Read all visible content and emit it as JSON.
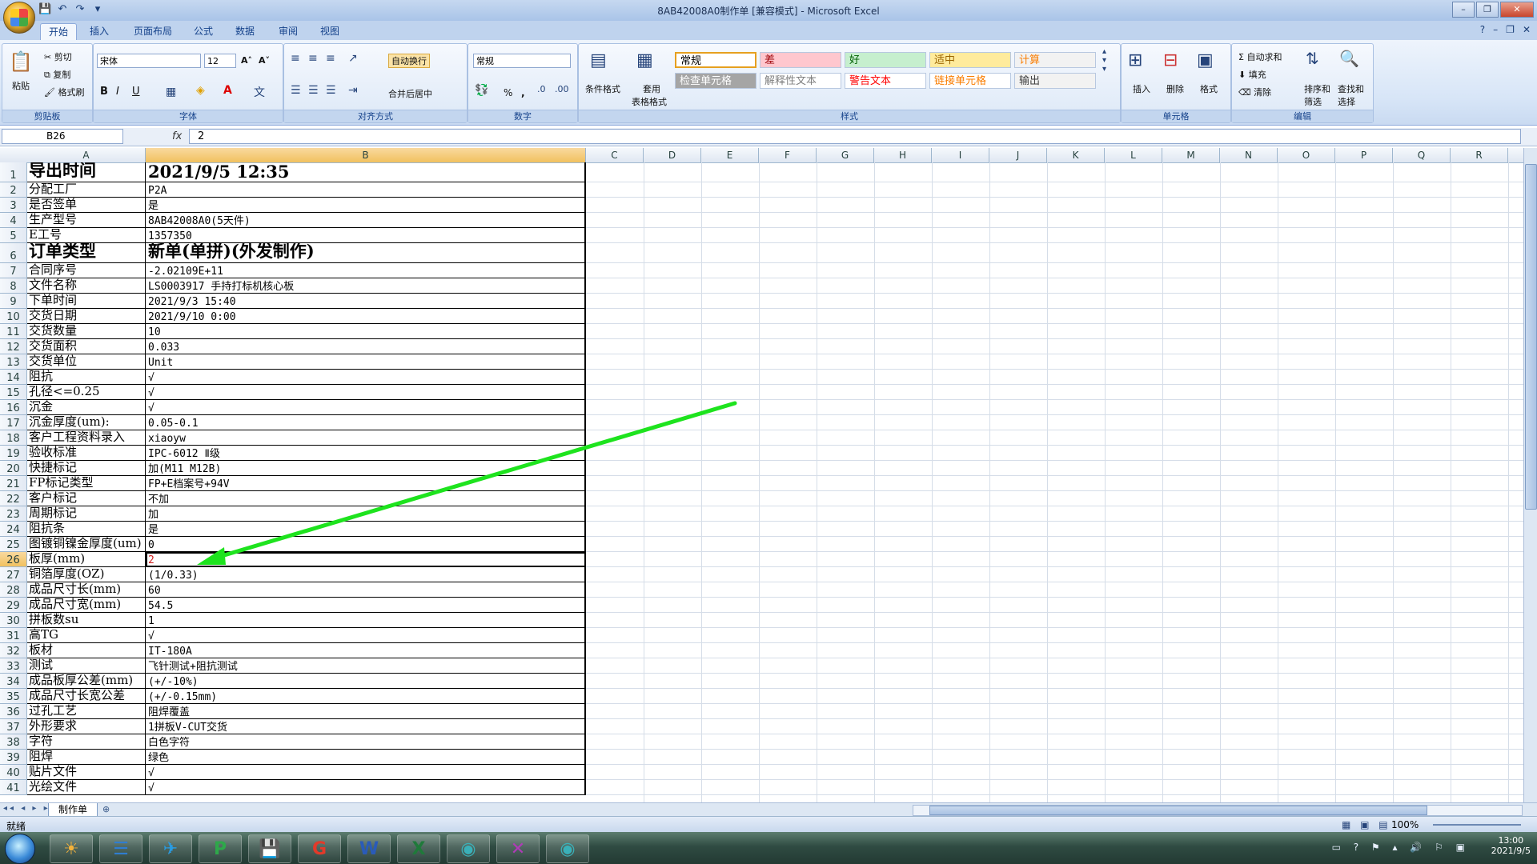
{
  "window": {
    "title": "8AB42008A0制作单  [兼容模式] - Microsoft Excel",
    "controls": [
      "–",
      "❐",
      "✕"
    ]
  },
  "qat": [
    "💾",
    "↶",
    "↷",
    "▾"
  ],
  "tabs": [
    "开始",
    "插入",
    "页面布局",
    "公式",
    "数据",
    "审阅",
    "视图"
  ],
  "ribbon": {
    "clipboard": {
      "paste": "粘贴",
      "cut": "剪切",
      "copy": "复制",
      "format_painter": "格式刷",
      "label": "剪贴板"
    },
    "font": {
      "name": "宋体",
      "size": "12",
      "bold": "B",
      "italic": "I",
      "underline": "U",
      "grow": "A˄",
      "shrink": "A˅",
      "label": "字体"
    },
    "alignment": {
      "wrap": "自动换行",
      "merge": "合并后居中",
      "label": "对齐方式"
    },
    "number": {
      "format": "常规",
      "percent": "%",
      "comma": ",",
      "label": "数字"
    },
    "styles": {
      "conditional": "条件格式",
      "table_format_1": "套用",
      "table_format_2": "表格格式",
      "cells": [
        {
          "text": "常规",
          "bg": "#ffffff",
          "fg": "#000000"
        },
        {
          "text": "差",
          "bg": "#ffc7ce",
          "fg": "#9c0006"
        },
        {
          "text": "好",
          "bg": "#c6efce",
          "fg": "#006100"
        },
        {
          "text": "适中",
          "bg": "#ffeb9c",
          "fg": "#9c6500"
        },
        {
          "text": "计算",
          "bg": "#f2f2f2",
          "fg": "#fa7d00"
        },
        {
          "text": "检查单元格",
          "bg": "#a5a5a5",
          "fg": "#ffffff"
        },
        {
          "text": "解释性文本",
          "bg": "#ffffff",
          "fg": "#7f7f7f"
        },
        {
          "text": "警告文本",
          "bg": "#ffffff",
          "fg": "#ff0000"
        },
        {
          "text": "链接单元格",
          "bg": "#ffffff",
          "fg": "#fa7d00"
        },
        {
          "text": "输出",
          "bg": "#f2f2f2",
          "fg": "#3f3f3f"
        }
      ],
      "label": "样式"
    },
    "cells": {
      "insert": "插入",
      "delete": "删除",
      "format": "格式",
      "label": "单元格"
    },
    "editing": {
      "autosum": "Σ 自动求和",
      "fill": "填充",
      "clear": "清除",
      "sort_1": "排序和",
      "sort_2": "筛选",
      "find_1": "查找和",
      "find_2": "选择",
      "label": "编辑"
    }
  },
  "formula_bar": {
    "name_box": "B26",
    "fx": "fx",
    "content": "2"
  },
  "columns": [
    "A",
    "B",
    "C",
    "D",
    "E",
    "F",
    "G",
    "H",
    "I",
    "J",
    "K",
    "L",
    "M",
    "N",
    "O",
    "P",
    "Q",
    "R"
  ],
  "rows": [
    {
      "n": "1",
      "a": "导出时间",
      "b": "2021/9/5 12:35",
      "big": true
    },
    {
      "n": "2",
      "a": "分配工厂",
      "b": "P2A"
    },
    {
      "n": "3",
      "a": "是否签单",
      "b": "是"
    },
    {
      "n": "4",
      "a": "生产型号",
      "b": "8AB42008A0(5天件)"
    },
    {
      "n": "5",
      "a": "E工号",
      "b": "1357350"
    },
    {
      "n": "6",
      "a": "订单类型",
      "b": "新单(单拼)(外发制作)",
      "big": true
    },
    {
      "n": "7",
      "a": "合同序号",
      "b": "-2.02109E+11"
    },
    {
      "n": "8",
      "a": "文件名称",
      "b": "LS0003917 手持打标机核心板"
    },
    {
      "n": "9",
      "a": "下单时间",
      "b": "2021/9/3 15:40"
    },
    {
      "n": "10",
      "a": "交货日期",
      "b": "2021/9/10 0:00"
    },
    {
      "n": "11",
      "a": "交货数量",
      "b": "10"
    },
    {
      "n": "12",
      "a": "交货面积",
      "b": "0.033"
    },
    {
      "n": "13",
      "a": "交货单位",
      "b": "Unit"
    },
    {
      "n": "14",
      "a": "阻抗",
      "b": "√"
    },
    {
      "n": "15",
      "a": "孔径<=0.25",
      "b": "√"
    },
    {
      "n": "16",
      "a": "沉金",
      "b": "√"
    },
    {
      "n": "17",
      "a": "沉金厚度(um):",
      "b": "0.05-0.1"
    },
    {
      "n": "18",
      "a": "客户工程资料录入",
      "b": "xiaoyw"
    },
    {
      "n": "19",
      "a": "验收标准",
      "b": "IPC-6012 Ⅱ级"
    },
    {
      "n": "20",
      "a": "快捷标记",
      "b": "加(M11 M12B)"
    },
    {
      "n": "21",
      "a": "FP标记类型",
      "b": "FP+E档案号+94V"
    },
    {
      "n": "22",
      "a": "客户标记",
      "b": "不加"
    },
    {
      "n": "23",
      "a": "周期标记",
      "b": "加"
    },
    {
      "n": "24",
      "a": "阻抗条",
      "b": "是"
    },
    {
      "n": "25",
      "a": "图镀铜镍金厚度(um)",
      "b": "0"
    },
    {
      "n": "26",
      "a": "板厚(mm)",
      "b": "2",
      "selected": true
    },
    {
      "n": "27",
      "a": "铜箔厚度(OZ)",
      "b": "(1/0.33)"
    },
    {
      "n": "28",
      "a": "成品尺寸长(mm)",
      "b": "60"
    },
    {
      "n": "29",
      "a": "成品尺寸宽(mm)",
      "b": "54.5"
    },
    {
      "n": "30",
      "a": "拼板数su",
      "b": "1"
    },
    {
      "n": "31",
      "a": "高TG",
      "b": "√"
    },
    {
      "n": "32",
      "a": "板材",
      "b": "IT-180A"
    },
    {
      "n": "33",
      "a": "测试",
      "b": "飞针测试+阻抗测试"
    },
    {
      "n": "34",
      "a": "成品板厚公差(mm)",
      "b": "(+/-10%)"
    },
    {
      "n": "35",
      "a": "成品尺寸长宽公差",
      "b": "(+/-0.15mm)"
    },
    {
      "n": "36",
      "a": "过孔工艺",
      "b": "阻焊覆盖"
    },
    {
      "n": "37",
      "a": "外形要求",
      "b": "1拼板V-CUT交货"
    },
    {
      "n": "38",
      "a": "字符",
      "b": "白色字符"
    },
    {
      "n": "39",
      "a": "阻焊",
      "b": "绿色"
    },
    {
      "n": "40",
      "a": "贴片文件",
      "b": "√"
    },
    {
      "n": "41",
      "a": "光绘文件",
      "b": "√"
    }
  ],
  "sheet": {
    "nav": "◂◂ ◂ ▸ ▸▸",
    "tab": "制作单",
    "new": "⊕"
  },
  "status": {
    "ready": "就绪",
    "zoom": "100%",
    "views": "▦ ▣ ▤"
  },
  "annotation": {
    "color": "#1ee31e"
  },
  "taskbar": {
    "apps": [
      {
        "glyph": "☀",
        "color": "#f3b23a"
      },
      {
        "glyph": "☰",
        "color": "#2f7dd0"
      },
      {
        "glyph": "✈",
        "color": "#2a9be0"
      },
      {
        "glyph": "P",
        "color": "#2ea84a"
      },
      {
        "glyph": "💾",
        "color": "#2c5fb3"
      },
      {
        "glyph": "G",
        "color": "#e23a2a"
      },
      {
        "glyph": "W",
        "color": "#2a5bb8"
      },
      {
        "glyph": "X",
        "color": "#1f7a3a"
      },
      {
        "glyph": "◉",
        "color": "#3ab0b8"
      },
      {
        "glyph": "✕",
        "color": "#b03ab8"
      },
      {
        "glyph": "◉",
        "color": "#3ab0b8"
      }
    ],
    "tray_icons": "▭ ? ⚑ ▴ 🔊 ⚐ ▣",
    "time": "13:00",
    "date": "2021/9/5"
  }
}
